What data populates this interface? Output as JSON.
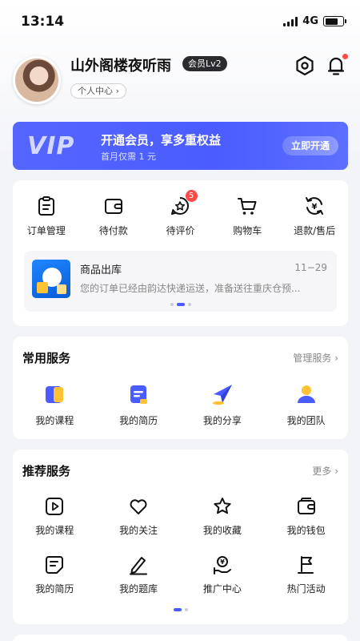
{
  "status_bar": {
    "time": "13:14",
    "network": "4G",
    "battery_level": 0.75
  },
  "profile": {
    "username": "山外阁楼夜听雨",
    "member_badge": "会员Lv2",
    "personal_center": "个人中心 ›"
  },
  "vip_banner": {
    "logo": "VIP",
    "title": "开通会员，享多重权益",
    "subtitle": "首月仅需 1 元",
    "button": "立即开通"
  },
  "orders": {
    "items": [
      {
        "label": "订单管理",
        "icon": "clipboard-icon"
      },
      {
        "label": "待付款",
        "icon": "wallet-icon"
      },
      {
        "label": "待评价",
        "icon": "review-star-icon",
        "badge": "5"
      },
      {
        "label": "购物车",
        "icon": "cart-icon"
      },
      {
        "label": "退款/售后",
        "icon": "refund-icon"
      }
    ],
    "shipment": {
      "title": "商品出库",
      "date": "11−29",
      "description": "您的订单已经由韵达快递运送，准备送往重庆仓预..."
    }
  },
  "common_services": {
    "title": "常用服务",
    "link": "管理服务 ›",
    "items": [
      {
        "label": "我的课程",
        "icon": "course-icon"
      },
      {
        "label": "我的简历",
        "icon": "resume-icon"
      },
      {
        "label": "我的分享",
        "icon": "share-plane-icon"
      },
      {
        "label": "我的团队",
        "icon": "team-icon"
      }
    ]
  },
  "recommended_services": {
    "title": "推荐服务",
    "link": "更多 ›",
    "items": [
      {
        "label": "我的课程",
        "icon": "play-icon"
      },
      {
        "label": "我的关注",
        "icon": "heart-icon"
      },
      {
        "label": "我的收藏",
        "icon": "star-icon"
      },
      {
        "label": "我的钱包",
        "icon": "wallet-icon"
      },
      {
        "label": "我的简历",
        "icon": "document-icon"
      },
      {
        "label": "我的题库",
        "icon": "pen-icon"
      },
      {
        "label": "推广中心",
        "icon": "promotion-icon"
      },
      {
        "label": "热门活动",
        "icon": "flag-icon"
      }
    ]
  },
  "colors": {
    "accent": "#4a5cff",
    "badge": "#ff4a4a"
  }
}
